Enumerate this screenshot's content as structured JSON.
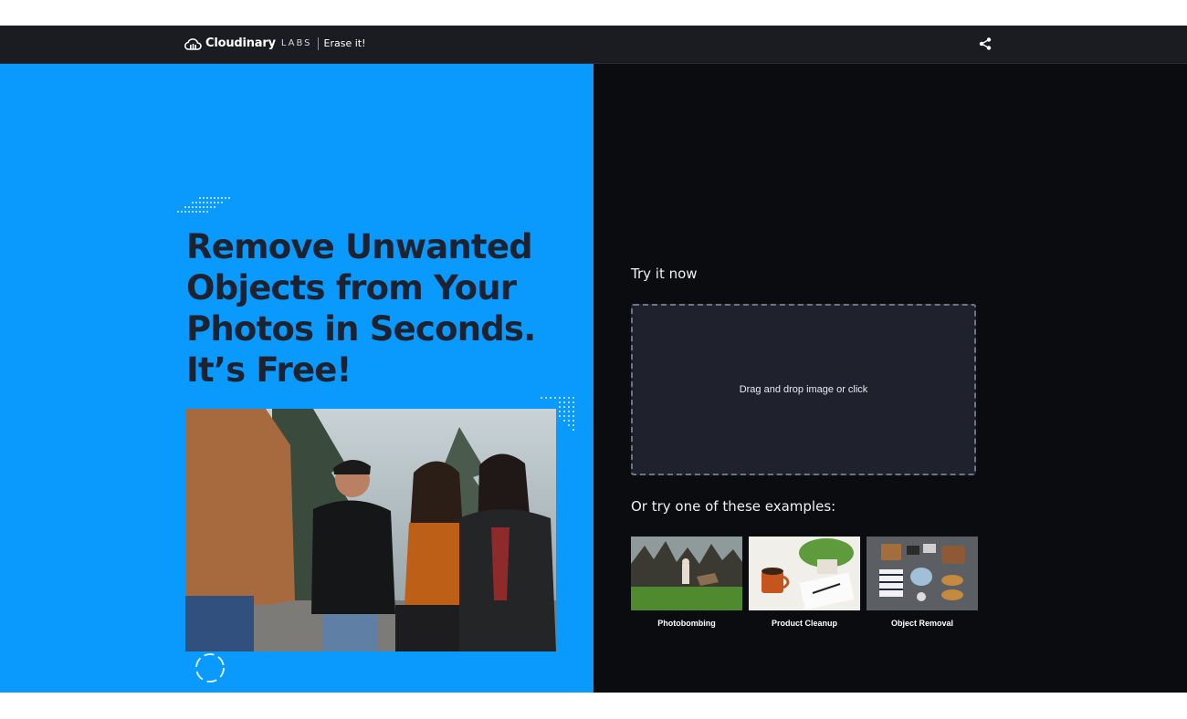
{
  "header": {
    "brand_name": "Cloudinary",
    "brand_suffix": "LABS",
    "product_name": "Erase it!",
    "logo_icon": "cloudinary-cloud-icon",
    "share_icon": "share-icon"
  },
  "hero": {
    "headline_lines": [
      "Remove Unwanted",
      "Objects from Your",
      "Photos in Seconds.",
      "It’s Free!"
    ],
    "image_alt": "Group photo",
    "spinner_icon": "loading-spinner-icon"
  },
  "upload": {
    "title": "Try it now",
    "dropzone_text": "Drag and drop image or click"
  },
  "examples": {
    "title": "Or try one of these examples:",
    "items": [
      {
        "label": "Photobombing"
      },
      {
        "label": "Product Cleanup"
      },
      {
        "label": "Object Removal"
      }
    ]
  },
  "colors": {
    "topbar": "#1a1c22",
    "left_panel": "#0a99fc",
    "right_panel": "#0b0c10",
    "headline": "#1c2230",
    "dropzone_bg": "#1f222c"
  }
}
